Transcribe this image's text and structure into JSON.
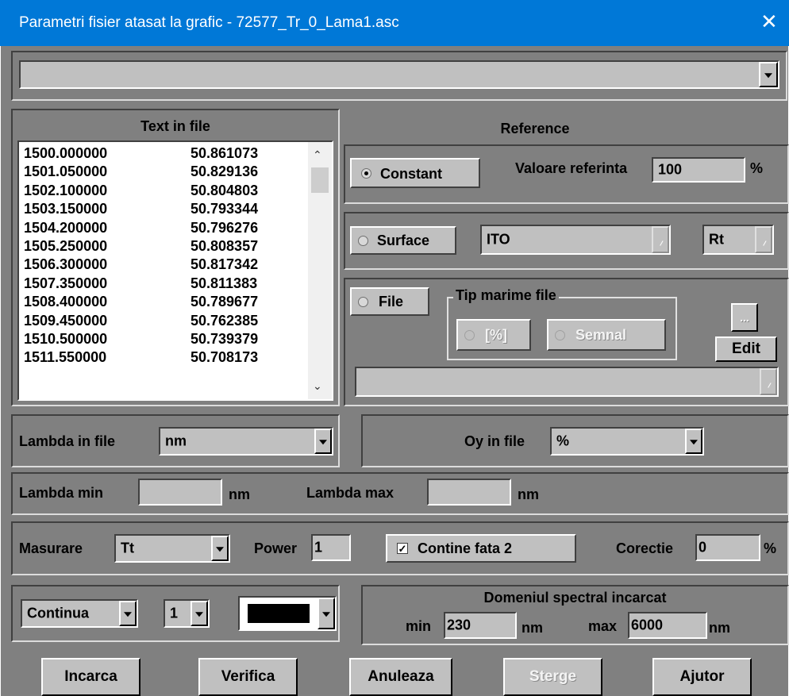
{
  "window": {
    "title": "Parametri fisier atasat la grafic  - 72577_Tr_0_Lama1.asc",
    "close_icon": "close-icon"
  },
  "top_combo": {
    "value": ""
  },
  "text_in_file": {
    "header": "Text in file",
    "rows": [
      [
        "1500.000000",
        "50.861073"
      ],
      [
        "1501.050000",
        "50.829136"
      ],
      [
        "1502.100000",
        "50.804803"
      ],
      [
        "1503.150000",
        "50.793344"
      ],
      [
        "1504.200000",
        "50.796276"
      ],
      [
        "1505.250000",
        "50.808357"
      ],
      [
        "1506.300000",
        "50.817342"
      ],
      [
        "1507.350000",
        "50.811383"
      ],
      [
        "1508.400000",
        "50.789677"
      ],
      [
        "1509.450000",
        "50.762385"
      ],
      [
        "1510.500000",
        "50.739379"
      ],
      [
        "1511.550000",
        "50.708173"
      ]
    ]
  },
  "reference": {
    "header": "Reference",
    "constant_label": "Constant",
    "valoare_label": "Valoare referinta",
    "valoare_value": "100",
    "valoare_unit": "%",
    "surface_label": "Surface",
    "surface_material": "ITO",
    "surface_type": "Rt",
    "file_label": "File",
    "tip_marime_label": "Tip marime file",
    "tip_percent_label": "[%]",
    "tip_semnal_label": "Semnal",
    "browse_label": "...",
    "edit_label": "Edit",
    "file_combo_value": ""
  },
  "lambda_in_file": {
    "label": "Lambda in file",
    "value": "nm"
  },
  "oy_in_file": {
    "label": "Oy in file",
    "value": "%"
  },
  "lambda_range": {
    "min_label": "Lambda min",
    "min_value": "",
    "min_unit": "nm",
    "max_label": "Lambda max",
    "max_value": "",
    "max_unit": "nm"
  },
  "measurement": {
    "masurare_label": "Masurare",
    "masurare_value": "Tt",
    "power_label": "Power",
    "power_value": "1",
    "contine_label": "Contine fata 2",
    "contine_checked": true,
    "corectie_label": "Corectie",
    "corectie_value": "0",
    "corectie_unit": "%"
  },
  "line_style": {
    "style_value": "Continua",
    "width_value": "1",
    "color_value": "#000000"
  },
  "domain": {
    "header": "Domeniul spectral incarcat",
    "min_label": "min",
    "min_value": "230",
    "min_unit": "nm",
    "max_label": "max",
    "max_value": "6000",
    "max_unit": "nm"
  },
  "buttons": {
    "incarca": "Incarca",
    "verifica": "Verifica",
    "anuleaza": "Anuleaza",
    "sterge": "Sterge",
    "ajutor": "Ajutor"
  }
}
